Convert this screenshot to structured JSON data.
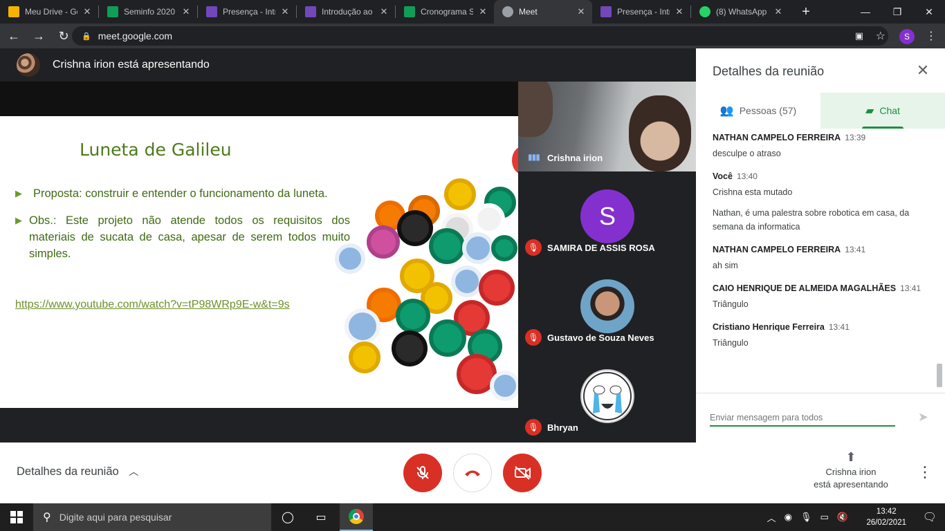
{
  "browser": {
    "tabs": [
      {
        "title": "Meu Drive - Go",
        "icon": "google-drive-icon",
        "color": "#f4b400",
        "active": false
      },
      {
        "title": "Seminfo 2020",
        "icon": "google-drive-icon",
        "color": "#0f9d58",
        "active": false
      },
      {
        "title": "Presença - Intr",
        "icon": "google-forms-icon",
        "color": "#7248b9",
        "active": false
      },
      {
        "title": "Introdução ao",
        "icon": "google-forms-icon",
        "color": "#7248b9",
        "active": false
      },
      {
        "title": "Cronograma S",
        "icon": "google-sheets-icon",
        "color": "#0f9d58",
        "active": false
      },
      {
        "title": "Meet",
        "icon": "globe-icon",
        "color": "#9aa0a6",
        "active": true
      },
      {
        "title": "Presença - Intr",
        "icon": "google-forms-icon",
        "color": "#7248b9",
        "active": false
      },
      {
        "title": "(8) WhatsApp",
        "icon": "whatsapp-icon",
        "color": "#25d366",
        "active": false
      }
    ],
    "url": "meet.google.com",
    "profile_initial": "S",
    "profile_color": "#8430ce"
  },
  "meet": {
    "presenter_banner": "Crishna irion está apresentando",
    "slide": {
      "title": "Luneta de Galileu",
      "bullet1": "Proposta: construir e entender o funcionamento da luneta.",
      "bullet2": "Obs.: Este projeto não atende todos os requisitos dos materiais de sucata de casa, apesar de serem todos muito simples.",
      "link": "https://www.youtube.com/watch?v=tP98WRp9E-w&t=9s"
    },
    "participants": [
      {
        "name": "Crishna irion",
        "speaking": true,
        "muted": false
      },
      {
        "name": "SAMIRA DE ASSIS ROSA",
        "initial": "S",
        "muted": true
      },
      {
        "name": "Gustavo de Souza Neves",
        "muted": true
      },
      {
        "name": "Bhryan",
        "muted": true
      }
    ]
  },
  "panel": {
    "title": "Detalhes da reunião",
    "tab_people": "Pessoas (57)",
    "tab_chat": "Chat",
    "messages": [
      {
        "author": "NATHAN CAMPELO FERREIRA",
        "time": "13:39",
        "lines": [
          "desculpe o atraso"
        ]
      },
      {
        "author": "Você",
        "time": "13:40",
        "lines": [
          "Crishna esta mutado",
          "Nathan, é uma palestra sobre robotica em casa, da semana da informatica"
        ]
      },
      {
        "author": "NATHAN CAMPELO FERREIRA",
        "time": "13:41",
        "lines": [
          "ah sim"
        ]
      },
      {
        "author": "CAIO HENRIQUE DE ALMEIDA MAGALHÃES",
        "time": "13:41",
        "lines": [
          "Triângulo"
        ]
      },
      {
        "author": "Cristiano Henrique Ferreira",
        "time": "13:41",
        "lines": [
          "Triângulo"
        ]
      }
    ],
    "input_placeholder": "Enviar mensagem para todos"
  },
  "bottombar": {
    "details_label": "Detalhes da reunião",
    "presenting_line1": "Crishna irion",
    "presenting_line2": "está apresentando",
    "accent_red": "#d93025"
  },
  "taskbar": {
    "search_placeholder": "Digite aqui para pesquisar",
    "time": "13:42",
    "date": "26/02/2021"
  }
}
